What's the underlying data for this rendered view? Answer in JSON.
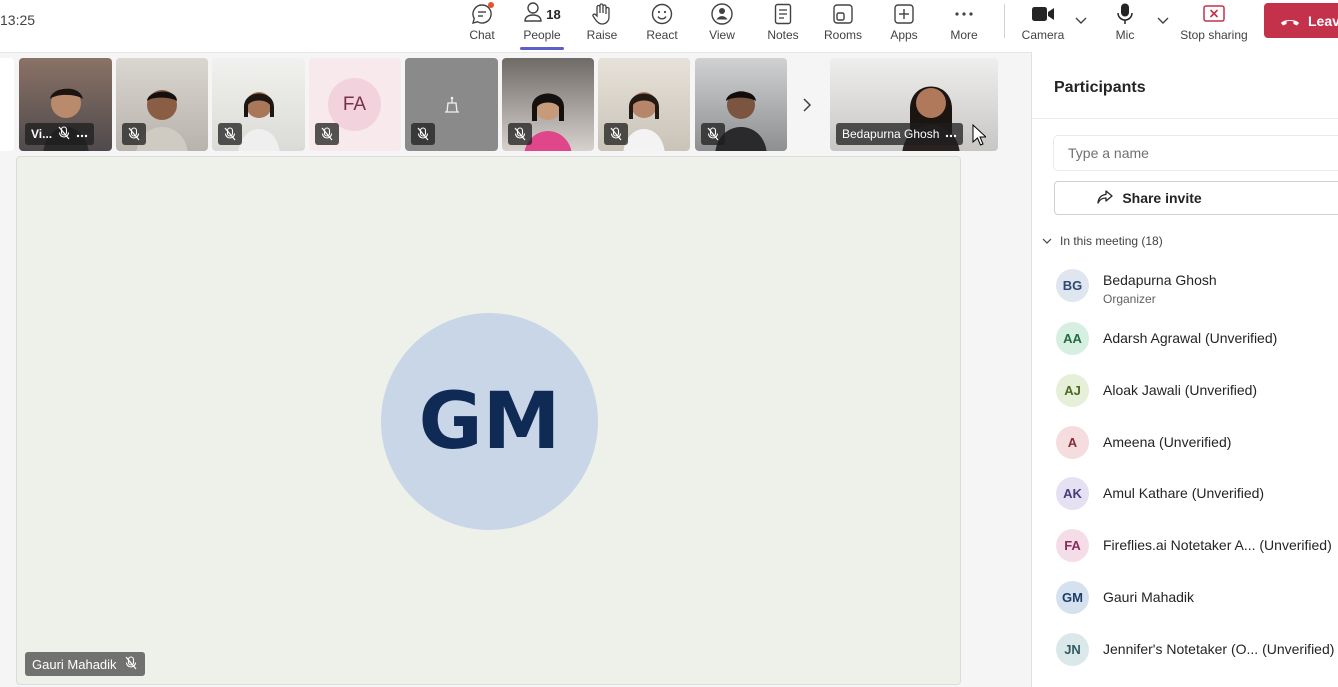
{
  "timer": "13:25",
  "toolbar": {
    "chat": "Chat",
    "people": "People",
    "people_count": "18",
    "raise": "Raise",
    "react": "React",
    "view": "View",
    "notes": "Notes",
    "rooms": "Rooms",
    "apps": "Apps",
    "more": "More",
    "camera": "Camera",
    "mic": "Mic",
    "stop_sharing": "Stop sharing",
    "leave": "Leave"
  },
  "strip": {
    "tile1_name": "Vi...",
    "fa_initials": "FA",
    "presenter_name": "Bedapurna Ghosh"
  },
  "stage": {
    "initials": "GM",
    "name": "Gauri Mahadik"
  },
  "panel": {
    "title": "Participants",
    "search_placeholder": "Type a name",
    "share_invite": "Share invite",
    "section": "In this meeting (18)",
    "participants": [
      {
        "initials": "BG",
        "name": "Bedapurna Ghosh",
        "role": "Organizer",
        "bg": "#dfe6f0",
        "fg": "#2b4a74"
      },
      {
        "initials": "AA",
        "name": "Adarsh Agrawal (Unverified)",
        "bg": "#d6efe1",
        "fg": "#246b45"
      },
      {
        "initials": "AJ",
        "name": "Aloak Jawali (Unverified)",
        "bg": "#e6efd8",
        "fg": "#4a6a23"
      },
      {
        "initials": "A",
        "name": "Ameena (Unverified)",
        "bg": "#f4dcdf",
        "fg": "#8a2c3a"
      },
      {
        "initials": "AK",
        "name": "Amul Kathare (Unverified)",
        "bg": "#e6e1f2",
        "fg": "#4b3c7c"
      },
      {
        "initials": "FA",
        "name": "Fireflies.ai Notetaker A...  (Unverified)",
        "bg": "#f5dde8",
        "fg": "#8a2c5c"
      },
      {
        "initials": "GM",
        "name": "Gauri Mahadik",
        "bg": "#d6e1ef",
        "fg": "#1f3d6a"
      },
      {
        "initials": "JN",
        "name": "Jennifer's Notetaker (O...  (Unverified)",
        "bg": "#dbe8ea",
        "fg": "#2e5c63"
      }
    ]
  }
}
